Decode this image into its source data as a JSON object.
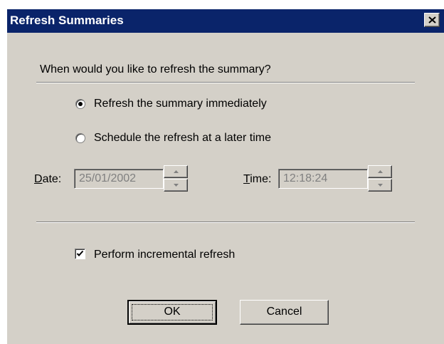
{
  "window": {
    "title": "Refresh Summaries",
    "close_icon": "close-icon"
  },
  "prompt": "When would you like to refresh the summary?",
  "options": [
    {
      "label": "Refresh the summary immediately",
      "selected": true
    },
    {
      "label": "Schedule the refresh at a later time",
      "selected": false
    }
  ],
  "date": {
    "label_accel": "D",
    "label_rest": "ate:",
    "value": "25/01/2002",
    "enabled": false
  },
  "time": {
    "label_accel": "T",
    "label_rest": "ime:",
    "value": "12:18:24",
    "enabled": false
  },
  "incremental": {
    "label": "Perform incremental refresh",
    "checked": true
  },
  "buttons": {
    "ok": "OK",
    "cancel": "Cancel"
  },
  "colors": {
    "titlebar": "#0a246a",
    "face": "#d4d0c8",
    "disabled_text": "#808080"
  }
}
